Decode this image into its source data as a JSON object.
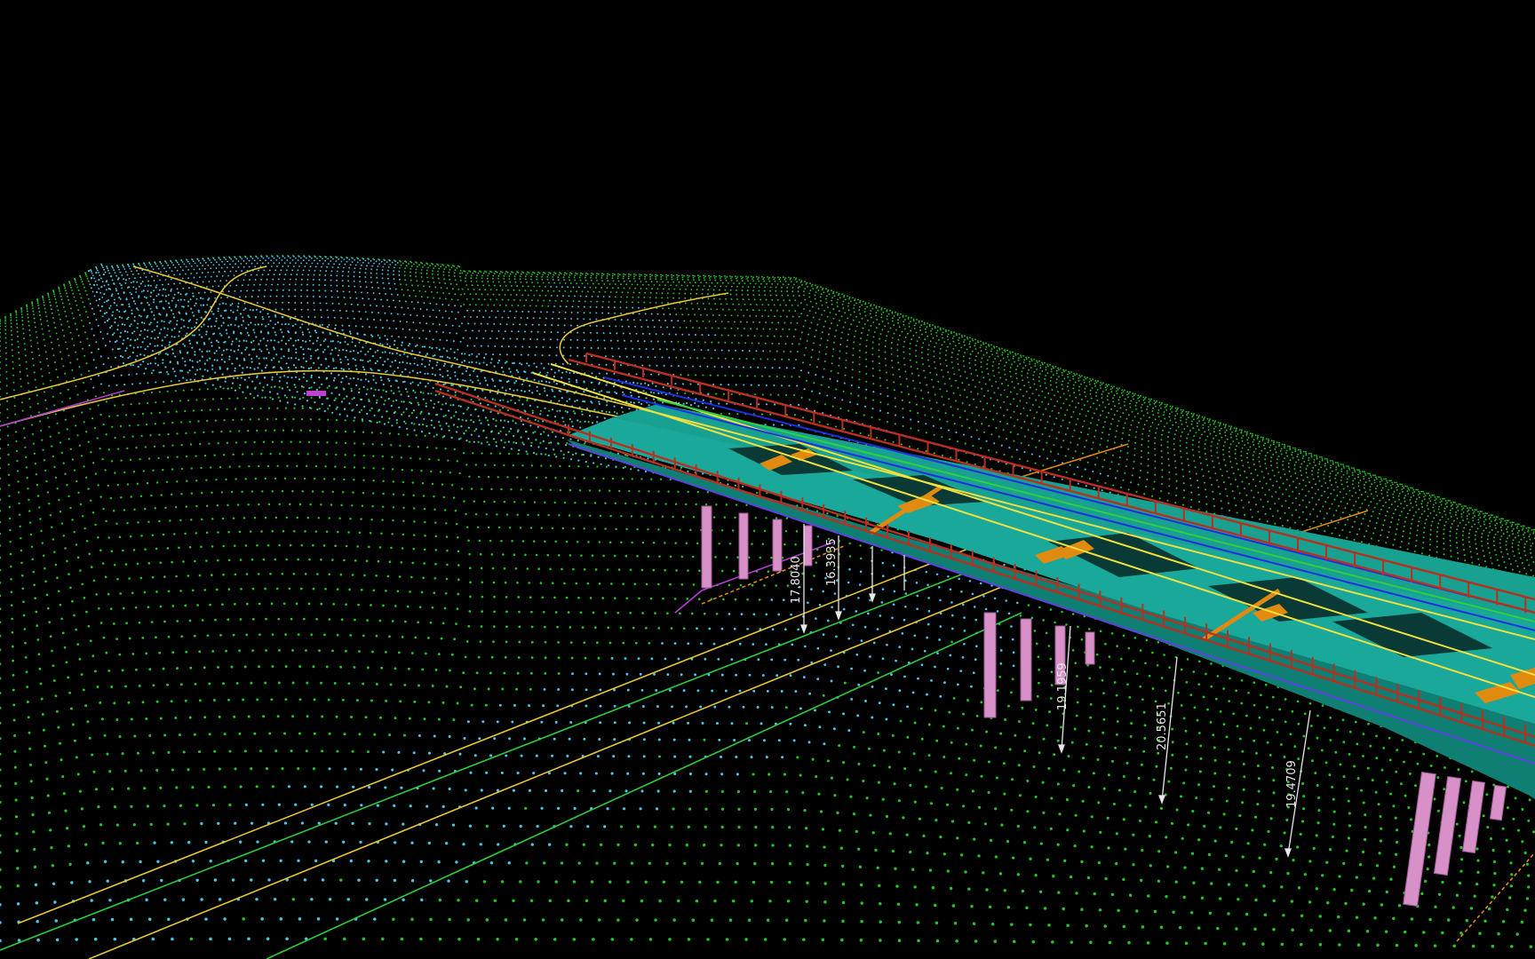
{
  "viewport": {
    "background": "#000000",
    "terrain_point_color": "#22c822",
    "road_point_color": "#45c8e6",
    "alignment_line_color": "#e6c832",
    "bridge_deck_color": "#1aa89a",
    "railing_color": "#b83020",
    "pier_color": "#d890c8",
    "bearing_color": "#e08a10",
    "dimension_color": "#e8e8e8"
  },
  "dimensions": [
    {
      "id": "dim-1",
      "text": "17.8040"
    },
    {
      "id": "dim-2",
      "text": "16.3935"
    },
    {
      "id": "dim-3",
      "text": "19.1959"
    },
    {
      "id": "dim-4",
      "text": "20.5651"
    },
    {
      "id": "dim-5",
      "text": "19.4709"
    }
  ]
}
